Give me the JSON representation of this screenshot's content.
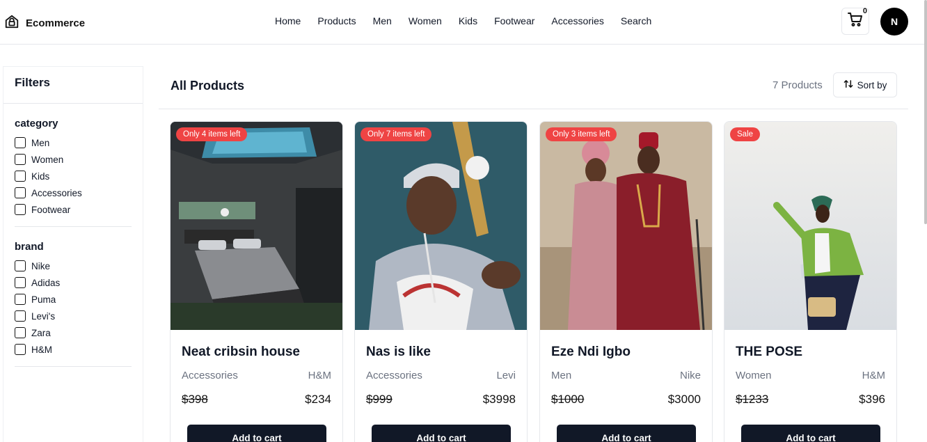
{
  "header": {
    "brand": "Ecommerce",
    "nav": [
      "Home",
      "Products",
      "Men",
      "Women",
      "Kids",
      "Footwear",
      "Accessories",
      "Search"
    ],
    "cart_count": "0",
    "avatar_initial": "N",
    "icons": {
      "brand": "shopping-bag-house-icon",
      "cart": "cart-icon"
    }
  },
  "sidebar": {
    "title": "Filters",
    "groups": [
      {
        "title": "category",
        "options": [
          "Men",
          "Women",
          "Kids",
          "Accessories",
          "Footwear"
        ]
      },
      {
        "title": "brand",
        "options": [
          "Nike",
          "Adidas",
          "Puma",
          "Levi's",
          "Zara",
          "H&M"
        ]
      }
    ]
  },
  "main": {
    "title": "All Products",
    "count_text": "7 Products",
    "sort_label": "Sort by",
    "sort_icon": "sort-arrows-icon"
  },
  "products": [
    {
      "badge": "Only 4 items left",
      "title": "Neat cribsin house",
      "category": "Accessories",
      "brand": "H&M",
      "old_price": "$398",
      "price": "$234",
      "button": "Add to cart",
      "image": "bedroom-with-skylight"
    },
    {
      "badge": "Only 7 items left",
      "title": "Nas is like",
      "category": "Accessories",
      "brand": "Levi",
      "old_price": "$999",
      "price": "$3998",
      "button": "Add to cart",
      "image": "man-with-baseball-bat"
    },
    {
      "badge": "Only 3 items left",
      "title": "Eze Ndi Igbo",
      "category": "Men",
      "brand": "Nike",
      "old_price": "$1000",
      "price": "$3000",
      "button": "Add to cart",
      "image": "couple-traditional-attire"
    },
    {
      "badge": "Sale",
      "title": "THE POSE",
      "category": "Women",
      "brand": "H&M",
      "old_price": "$1233",
      "price": "$396",
      "button": "Add to cart",
      "image": "woman-green-jacket-pose"
    }
  ],
  "colors": {
    "badge": "#ef4444",
    "button": "#111827",
    "border": "#e5e7eb",
    "muted": "#6b7280"
  }
}
